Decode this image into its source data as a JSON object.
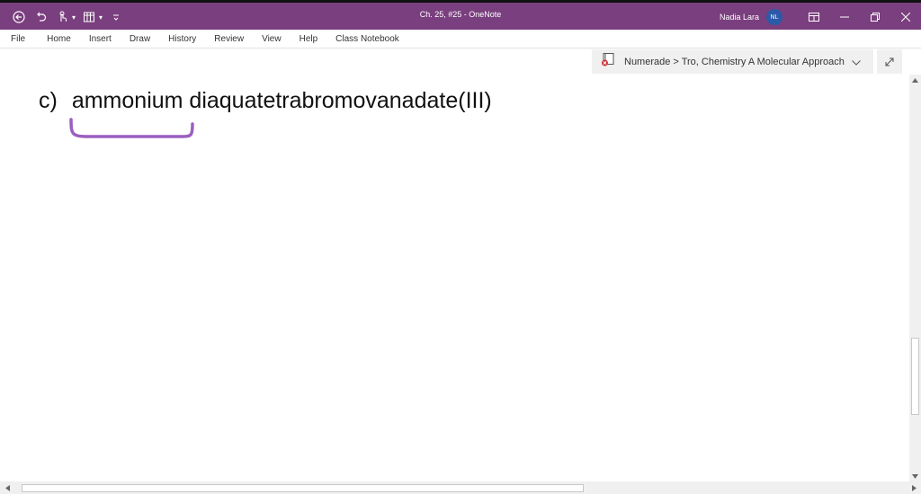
{
  "window": {
    "title": "Ch. 25, #25  -  OneNote",
    "user_name": "Nadia Lara",
    "user_initials": "NL",
    "accent": "#7a3f7e"
  },
  "quick_access": {
    "icons": [
      "back-icon",
      "undo-icon",
      "touch-mode-icon",
      "table-icon",
      "customize-icon"
    ]
  },
  "menu": {
    "items": [
      "File",
      "Home",
      "Insert",
      "Draw",
      "History",
      "Review",
      "View",
      "Help",
      "Class Notebook"
    ]
  },
  "notebook": {
    "path": "Numerade > Tro, Chemistry A Molecular Approach"
  },
  "page": {
    "prefix": "c)",
    "text": "ammonium diaquatetrabromovanadate(III)",
    "ink_color": "#9b5fc0"
  }
}
